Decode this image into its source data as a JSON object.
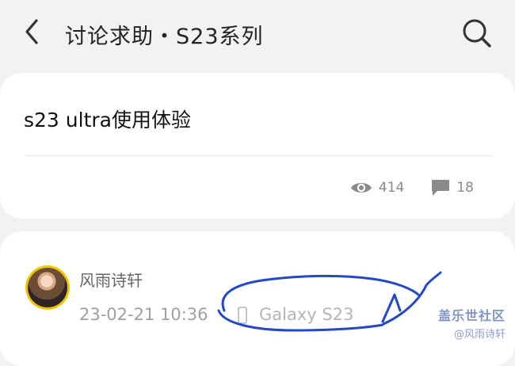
{
  "header": {
    "title": "讨论求助・S23系列",
    "back_icon": "back-arrow-icon",
    "search_icon": "search-icon"
  },
  "post": {
    "title": "s23 ultra使用体验",
    "views": "414",
    "comments": "18"
  },
  "reply": {
    "author": "风雨诗轩",
    "timestamp": "23-02-21 10:36",
    "device": "Galaxy S23"
  },
  "watermark": {
    "brand": "盖乐世社区",
    "user": "@风雨诗轩"
  },
  "colors": {
    "background": "#f2f2f2",
    "card": "#ffffff",
    "avatar_ring": "#f3c400",
    "annotation_ink": "#2348c8"
  }
}
